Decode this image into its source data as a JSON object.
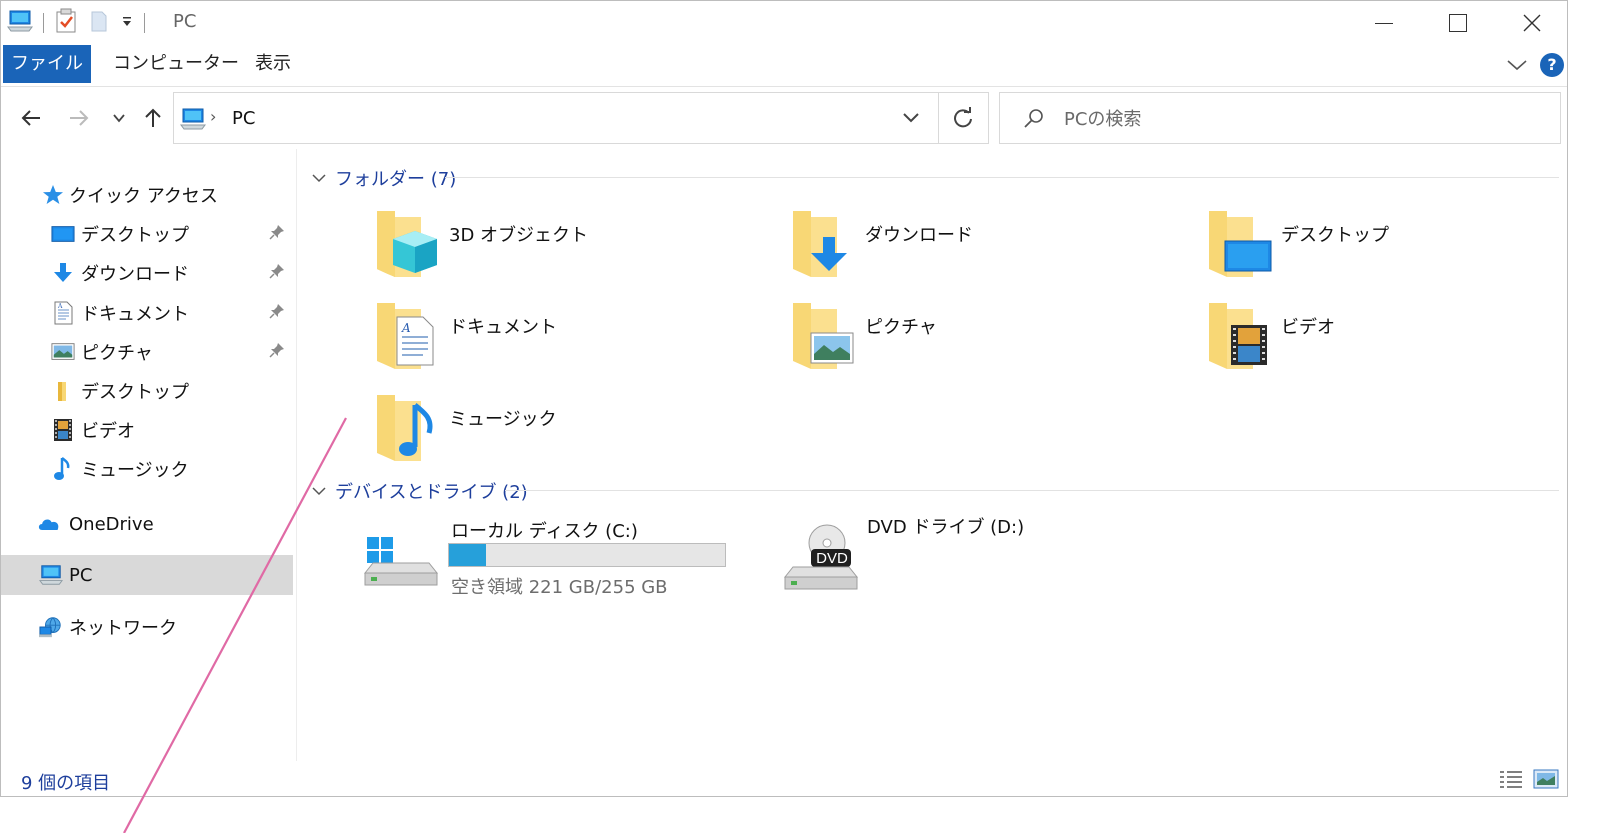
{
  "window": {
    "title": "PC",
    "accent_color": "#1a64b8",
    "annotation_line_color": "#e06aa5"
  },
  "quick_access_toolbar": {
    "icons": [
      "pc-icon",
      "properties-icon",
      "new-folder-icon",
      "customize-dropdown-icon"
    ]
  },
  "ribbon": {
    "tabs": [
      {
        "label": "ファイル",
        "active": true
      },
      {
        "label": "コンピューター",
        "active": false
      },
      {
        "label": "表示",
        "active": false
      }
    ],
    "help_label": "?"
  },
  "nav": {
    "breadcrumb": "PC",
    "search_placeholder": "PCの検索"
  },
  "sidebar": {
    "quick_access_label": "クイック アクセス",
    "items": [
      {
        "label": "デスクトップ",
        "icon": "desktop-icon",
        "pinned": true
      },
      {
        "label": "ダウンロード",
        "icon": "download-icon",
        "pinned": true
      },
      {
        "label": "ドキュメント",
        "icon": "document-icon",
        "pinned": true
      },
      {
        "label": "ピクチャ",
        "icon": "picture-icon",
        "pinned": true
      },
      {
        "label": "デスクトップ",
        "icon": "folder-icon",
        "pinned": false
      },
      {
        "label": "ビデオ",
        "icon": "video-icon",
        "pinned": false
      },
      {
        "label": "ミュージック",
        "icon": "music-icon",
        "pinned": false
      }
    ],
    "onedrive_label": "OneDrive",
    "pc_label": "PC",
    "network_label": "ネットワーク"
  },
  "content": {
    "folders_header": "フォルダー (7)",
    "folders": [
      {
        "label": "3D オブジェクト",
        "icon": "3d-objects-folder-icon"
      },
      {
        "label": "ダウンロード",
        "icon": "downloads-folder-icon"
      },
      {
        "label": "デスクトップ",
        "icon": "desktop-folder-icon"
      },
      {
        "label": "ドキュメント",
        "icon": "documents-folder-icon"
      },
      {
        "label": "ピクチャ",
        "icon": "pictures-folder-icon"
      },
      {
        "label": "ビデオ",
        "icon": "videos-folder-icon"
      },
      {
        "label": "ミュージック",
        "icon": "music-folder-icon"
      }
    ],
    "devices_header": "デバイスとドライブ (2)",
    "drives": [
      {
        "label": "ローカル ディスク (C:)",
        "free": "空き領域 221 GB/255 GB",
        "used_fraction": 0.133
      },
      {
        "label": "DVD ドライブ (D:)",
        "badge": "DVD"
      }
    ]
  },
  "status": {
    "item_count": "9 個の項目"
  }
}
